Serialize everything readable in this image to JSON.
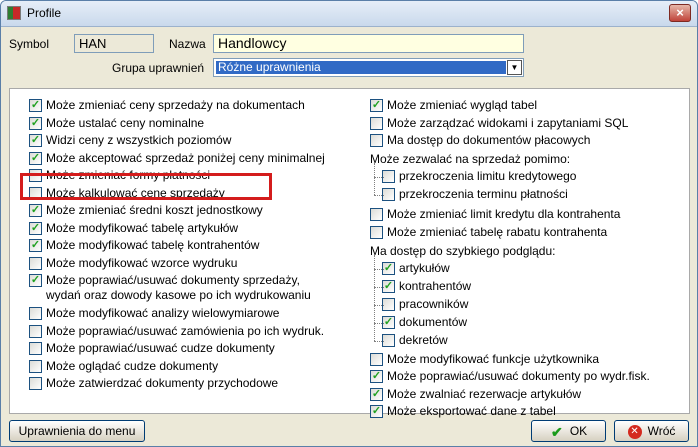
{
  "window": {
    "title": "Profile",
    "close_label": "×"
  },
  "header": {
    "symbol_label": "Symbol",
    "symbol_value": "HAN",
    "nazwa_label": "Nazwa",
    "nazwa_value": "Handlowcy",
    "grupa_label": "Grupa uprawnień",
    "grupa_value": "Różne uprawnienia"
  },
  "left_items": [
    {
      "label": "Może zmieniać ceny sprzedaży na dokumentach",
      "checked": true
    },
    {
      "label": "Może ustalać ceny nominalne",
      "checked": true
    },
    {
      "label": "Widzi ceny z wszystkich poziomów",
      "checked": true
    },
    {
      "label": "Może akceptować sprzedaż poniżej ceny minimalnej",
      "checked": true
    },
    {
      "label": "Może zmieniać formy płatności",
      "checked": false
    },
    {
      "label": "Może kalkulować cenę sprzedaży",
      "checked": false
    },
    {
      "label": "Może zmieniać średni koszt jednostkowy",
      "checked": true
    },
    {
      "label": "Może modyfikować tabelę artykułów",
      "checked": true
    },
    {
      "label": "Może modyfikować tabelę kontrahentów",
      "checked": true
    },
    {
      "label": "Może modyfikować wzorce wydruku",
      "checked": false
    },
    {
      "label": "Może poprawiać/usuwać dokumenty sprzedaży,",
      "label2": "wydań oraz dowody kasowe po ich wydrukowaniu",
      "checked": true
    },
    {
      "label": "Może modyfikować analizy wielowymiarowe",
      "checked": false
    },
    {
      "label": "Może poprawiać/usuwać zamówienia po ich wydruk.",
      "checked": false
    },
    {
      "label": "Może poprawiać/usuwać cudze dokumenty",
      "checked": false
    },
    {
      "label": "Może oglądać cudze dokumenty",
      "checked": false
    },
    {
      "label": "Może zatwierdzać dokumenty przychodowe",
      "checked": false
    }
  ],
  "right_top": [
    {
      "label": "Może zmieniać wygląd tabel",
      "checked": true
    },
    {
      "label": "Może zarządzać widokami i zapytaniami SQL",
      "checked": false
    },
    {
      "label": "Ma dostęp do dokumentów płacowych",
      "checked": false
    }
  ],
  "sale_section_label": "Może zezwalać na sprzedaż pomimo:",
  "sale_items": [
    {
      "label": "przekroczenia limitu kredytowego",
      "checked": false
    },
    {
      "label": "przekroczenia terminu płatności",
      "checked": false
    }
  ],
  "right_mid": [
    {
      "label": "Może zmieniać limit kredytu dla kontrahenta",
      "checked": false
    },
    {
      "label": "Może zmieniać tabelę rabatu kontrahenta",
      "checked": false
    }
  ],
  "preview_section_label": "Ma dostęp do szybkiego podglądu:",
  "preview_items": [
    {
      "label": "artykułów",
      "checked": true
    },
    {
      "label": "kontrahentów",
      "checked": true
    },
    {
      "label": "pracowników",
      "checked": false
    },
    {
      "label": "dokumentów",
      "checked": true
    },
    {
      "label": "dekretów",
      "checked": false
    }
  ],
  "right_bottom": [
    {
      "label": "Może modyfikować funkcje użytkownika",
      "checked": false
    },
    {
      "label": "Może poprawiać/usuwać dokumenty po wydr.fisk.",
      "checked": true
    },
    {
      "label": "Może zwalniać rezerwacje artykułów",
      "checked": true
    },
    {
      "label": "Może eksportować dane z tabel",
      "checked": true
    }
  ],
  "footer": {
    "menu_button": "Uprawnienia do menu",
    "ok_button": "OK",
    "back_button": "Wróć"
  },
  "colors": {
    "highlight": "#d41c1c",
    "selection": "#316ac5",
    "nazwa_bg": "#ffffe1"
  },
  "icons": {
    "ok": "check-icon",
    "back": "cancel-icon",
    "app": "app-icon"
  }
}
